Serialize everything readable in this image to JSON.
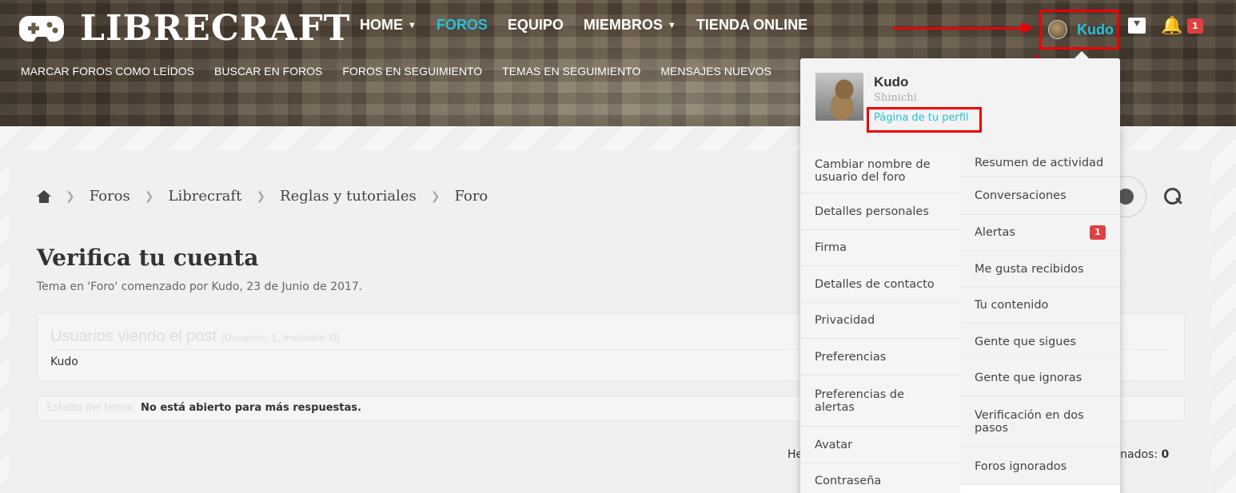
{
  "header": {
    "logo_text": "LIBRECRAFT",
    "nav": [
      {
        "label": "HOME",
        "has_dropdown": true,
        "active": false
      },
      {
        "label": "FOROS",
        "has_dropdown": false,
        "active": true
      },
      {
        "label": "EQUIPO",
        "has_dropdown": false,
        "active": false
      },
      {
        "label": "MIEMBROS",
        "has_dropdown": true,
        "active": false
      },
      {
        "label": "TIENDA ONLINE",
        "has_dropdown": false,
        "active": false
      }
    ],
    "subnav": [
      "MARCAR FOROS COMO LEÍDOS",
      "BUSCAR EN FOROS",
      "FOROS EN SEGUIMIENTO",
      "TEMAS EN SEGUIMIENTO",
      "MENSAJES NUEVOS"
    ],
    "user_name": "Kudo",
    "alert_count": "1"
  },
  "breadcrumb": [
    "Foros",
    "Librecraft",
    "Reglas y tutoriales",
    "Foro"
  ],
  "thread": {
    "title": "Verifica tu cuenta",
    "meta": "Tema en 'Foro' comenzado por Kudo, 23 de Junio de 2017."
  },
  "viewers": {
    "title": "Usuarios viendo el post",
    "count": "(Usuarios: 1, Invitados: 0)",
    "users": "Kudo"
  },
  "status": {
    "label": "Estado del tema:",
    "value": "No está abierto para más respuestas."
  },
  "footer": {
    "left": "He",
    "right_label": "cionados:",
    "right_value": "0"
  },
  "dropdown": {
    "name": "Kudo",
    "user_title": "Shinichi",
    "profile_link": "Página de tu perfil",
    "left_items": [
      "Cambiar nombre de usuario del foro",
      "Detalles personales",
      "Firma",
      "Detalles de contacto",
      "Privacidad",
      "Preferencias",
      "Preferencias de alertas",
      "Avatar",
      "Contraseña"
    ],
    "right_items": [
      {
        "label": "Resumen de actividad"
      },
      {
        "label": "Conversaciones"
      },
      {
        "label": "Alertas",
        "badge": "1"
      },
      {
        "label": "Me gusta recibidos"
      },
      {
        "label": "Tu contenido"
      },
      {
        "label": "Gente que sigues"
      },
      {
        "label": "Gente que ignoras"
      },
      {
        "label": "Verificación en dos pasos"
      },
      {
        "label": "Foros ignorados"
      }
    ]
  },
  "colors": {
    "accent": "#27c0dd",
    "annotation": "#ee0000",
    "badge": "#e04040"
  },
  "icons": [
    "gamepad-icon",
    "chevron-down-icon",
    "inbox-icon",
    "bell-icon",
    "home-icon",
    "compass-icon",
    "search-icon"
  ]
}
